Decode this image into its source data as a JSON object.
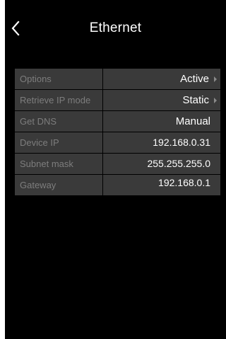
{
  "header": {
    "title": "Ethernet",
    "back_icon": "chevron-left-icon"
  },
  "settings": {
    "rows": [
      {
        "label": "Options",
        "value": "Active",
        "has_arrow": true
      },
      {
        "label": "Retrieve IP mode",
        "value": "Static",
        "has_arrow": true
      },
      {
        "label": "Get DNS",
        "value": "Manual",
        "has_arrow": false
      },
      {
        "label": "Device IP",
        "value": "192.168.0.31",
        "has_arrow": false
      },
      {
        "label": "Subnet mask",
        "value": "255.255.255.0",
        "has_arrow": false
      },
      {
        "label": "Gateway",
        "value": "192.168.0.1",
        "has_arrow": false
      }
    ]
  },
  "colors": {
    "background": "#000000",
    "row_background": "#3a3a3a",
    "label_text": "#7d7d7d",
    "value_text": "#ffffff"
  }
}
